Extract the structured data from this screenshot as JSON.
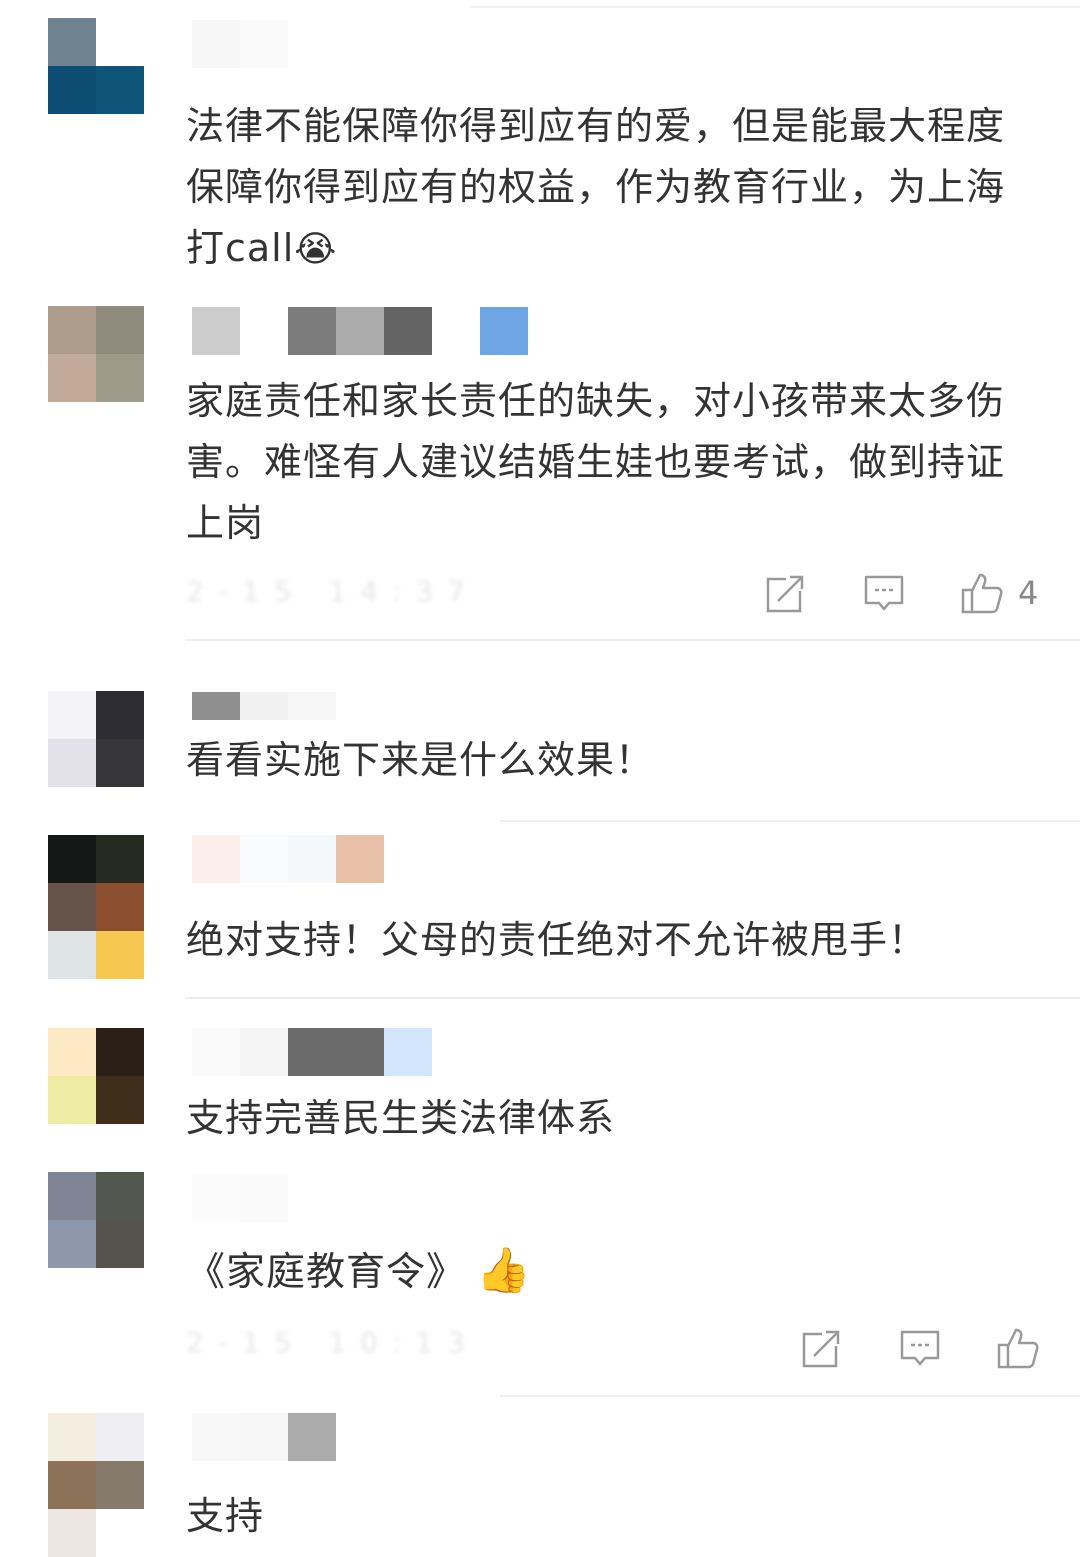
{
  "comments": [
    {
      "text": "法律不能保障你得到应有的爱，但是能最大程度保障你得到应有的权益，作为教育行业，为上海打call",
      "emoji": "😭"
    },
    {
      "text": "家庭责任和家长责任的缺失，对小孩带来太多伤害。难怪有人建议结婚生娃也要考试，做到持证上岗",
      "timestamp": "2-15 14:37",
      "like_count": "4"
    },
    {
      "text": "看看实施下来是什么效果！"
    },
    {
      "text": "绝对支持！父母的责任绝对不允许被甩手！"
    },
    {
      "text": "支持完善民生类法律体系"
    },
    {
      "text": "《家庭教育令》",
      "emoji": "👍",
      "timestamp": "2-15 10:13"
    },
    {
      "text": "支持"
    }
  ],
  "icons": {
    "share": "share-icon",
    "reply": "comment-icon",
    "like": "thumbs-up-icon"
  },
  "colors": {
    "text": "#333333",
    "icon": "#999999",
    "divider": "#eeeeee"
  }
}
